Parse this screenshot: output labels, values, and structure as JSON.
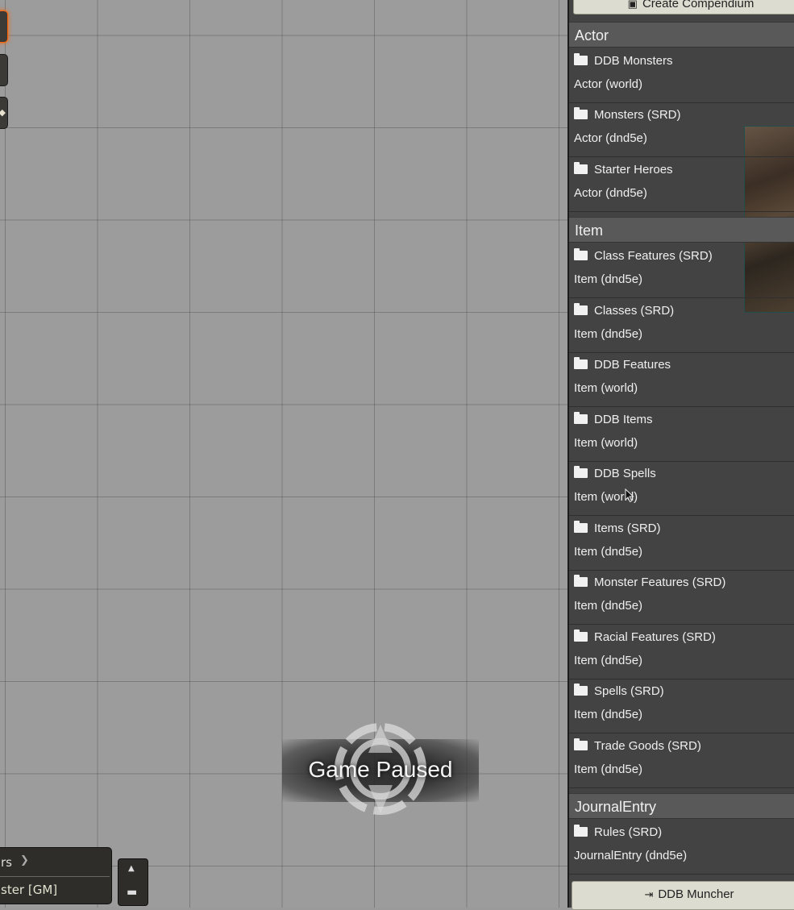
{
  "sidebar": {
    "create_button": "Create Compendium",
    "sections": [
      {
        "title": "Actor",
        "packs": [
          {
            "name": "DDB Monsters",
            "type": "Actor (world)"
          },
          {
            "name": "Monsters (SRD)",
            "type": "Actor (dnd5e)"
          },
          {
            "name": "Starter Heroes",
            "type": "Actor (dnd5e)"
          }
        ]
      },
      {
        "title": "Item",
        "packs": [
          {
            "name": "Class Features (SRD)",
            "type": "Item (dnd5e)"
          },
          {
            "name": "Classes (SRD)",
            "type": "Item (dnd5e)"
          },
          {
            "name": "DDB Features",
            "type": "Item (world)"
          },
          {
            "name": "DDB Items",
            "type": "Item (world)"
          },
          {
            "name": "DDB Spells",
            "type": "Item (world)"
          },
          {
            "name": "Items (SRD)",
            "type": "Item (dnd5e)"
          },
          {
            "name": "Monster Features (SRD)",
            "type": "Item (dnd5e)"
          },
          {
            "name": "Racial Features (SRD)",
            "type": "Item (dnd5e)"
          },
          {
            "name": "Spells (SRD)",
            "type": "Item (dnd5e)"
          },
          {
            "name": "Trade Goods (SRD)",
            "type": "Item (dnd5e)"
          }
        ]
      },
      {
        "title": "JournalEntry",
        "packs": [
          {
            "name": "Rules (SRD)",
            "type": "JournalEntry (dnd5e)"
          }
        ]
      }
    ],
    "footer_button": "DDB Muncher"
  },
  "canvas": {
    "paused_text": "Game Paused"
  },
  "players": {
    "header": "rs",
    "current": "ster [GM]"
  }
}
